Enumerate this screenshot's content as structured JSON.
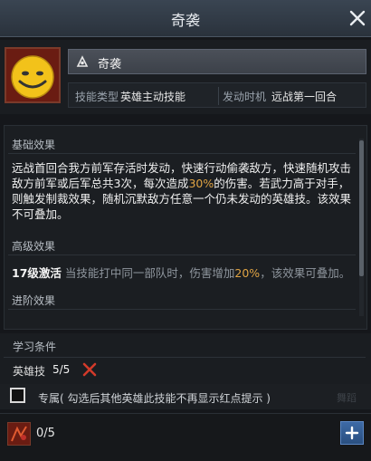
{
  "window": {
    "title": "奇袭"
  },
  "skill": {
    "name": "奇袭",
    "type_label": "技能类型",
    "type_value": "英雄主动技能",
    "timing_label": "发动时机",
    "timing_value": "远战第一回合"
  },
  "basic": {
    "title": "基础效果",
    "text_part1": "远战首回合我方前军存活时发动，快速行动偷袭敌方，快速随机攻击敌方前军或后军总共3次，每次造成",
    "highlight": "30%",
    "text_part2": "的伤害。若武力高于对手，则触发制裁效果，随机沉默敌方任意一个仍未发动的英雄技。该效果不可叠加。"
  },
  "advanced": {
    "title": "高级效果",
    "level_bold": "17级激活",
    "desc_part1": "当技能打中同一部队时，伤害增加",
    "highlight": "20%",
    "desc_part2": "，该效果可叠加。"
  },
  "progression": {
    "title": "进阶效果"
  },
  "learn": {
    "title": "学习条件",
    "requirement_label": "英雄技",
    "requirement_count": "5/5"
  },
  "exclusive": {
    "text": "专属( 勾选后其他英雄此技能不再显示红点提示 )",
    "ghost_text": "舞蹈"
  },
  "footer": {
    "count": "0/5"
  },
  "colors": {
    "highlight": "#e0a444",
    "close_x": "#d23a2a",
    "plus_button": "#3d6aa6"
  },
  "icons": [
    "close-icon",
    "hero-portrait",
    "skill-type-icon",
    "cross-mark-icon",
    "checkbox",
    "plus-icon"
  ]
}
